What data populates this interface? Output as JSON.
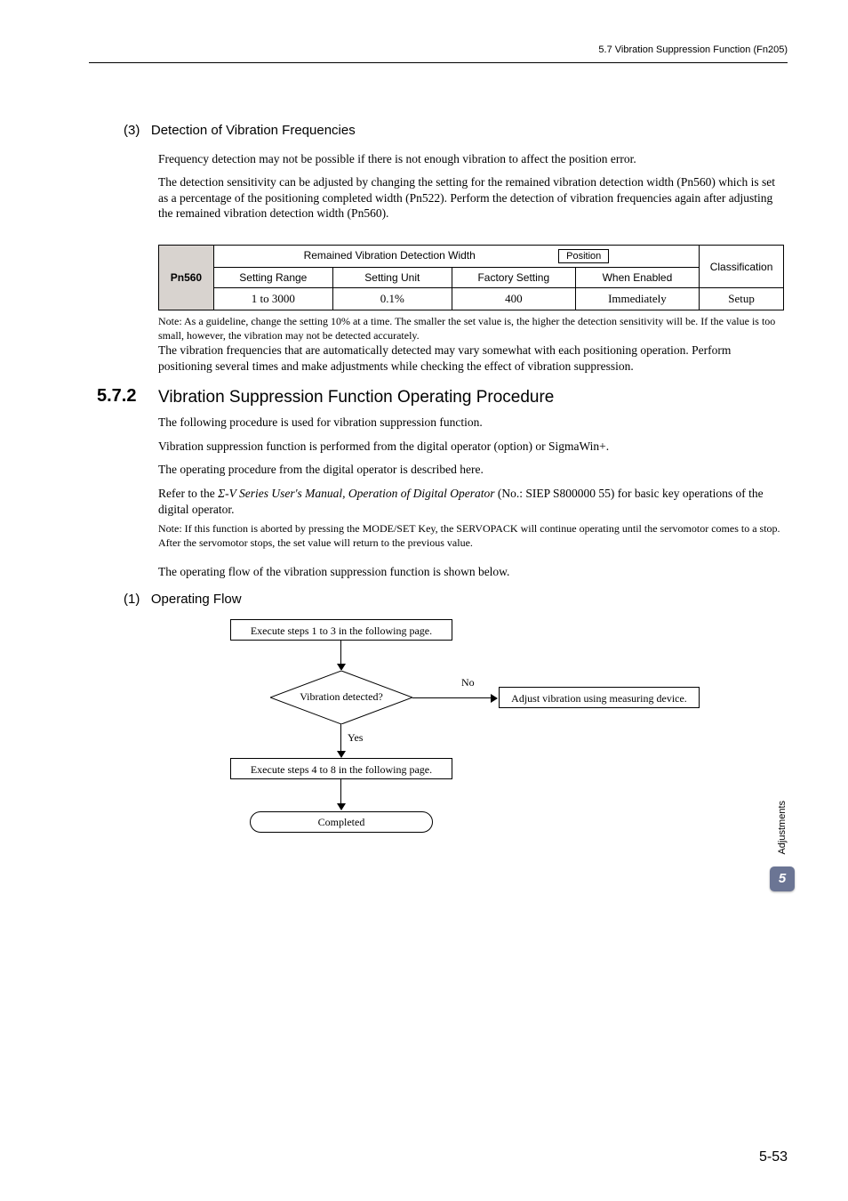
{
  "header": {
    "breadcrumb": "5.7  Vibration Suppression Function (Fn205)"
  },
  "section3": {
    "num": "(3)",
    "title": "Detection of Vibration Frequencies",
    "p1": "Frequency detection may not be possible if there is not enough vibration to affect the position error.",
    "p2": "The detection sensitivity can be adjusted by changing the setting for the remained vibration detection width (Pn560) which is set as a percentage of the positioning completed width (Pn522). Perform the detection of vibration frequencies again after adjusting the remained vibration detection width (Pn560)."
  },
  "param_table": {
    "pn": "Pn560",
    "title": "Remained Vibration Detection Width",
    "position_label": "Position",
    "classification_label": "Classification",
    "headers": {
      "range": "Setting Range",
      "unit": "Setting Unit",
      "factory": "Factory Setting",
      "enabled": "When Enabled"
    },
    "values": {
      "range": "1 to 3000",
      "unit": "0.1%",
      "factory": "400",
      "enabled": "Immediately",
      "classification": "Setup"
    }
  },
  "note1": {
    "prefix": "Note:",
    "body": "As a guideline, change the setting 10% at a time. The smaller the set value is, the higher the detection sensitivity will be. If the value is too small, however, the vibration may not be detected accurately."
  },
  "p3": "The vibration frequencies that are automatically detected may vary somewhat with each positioning operation. Perform positioning several times and make adjustments while checking the effect of vibration suppression.",
  "section572": {
    "num": "5.7.2",
    "title": "Vibration Suppression Function Operating Procedure",
    "p4": "The following procedure is used for vibration suppression function.",
    "p5": "Vibration suppression function is performed from the digital operator (option) or SigmaWin+.",
    "p6": "The operating procedure from the digital operator is described here.",
    "p7_pre": "Refer to the ",
    "p7_sigma": "Σ",
    "p7_italic": "-V Series User's Manual, Operation of Digital Operator",
    "p7_post": " (No.: SIEP S800000 55) for basic key operations of the digital operator.",
    "note2_prefix": "Note:",
    "note2_body": "If this function is aborted by pressing the MODE/SET Key, the SERVOPACK will continue operating until the servomotor comes to a stop. After the servomotor stops, the set value will return to the previous value.",
    "p8": "The operating flow of the vibration suppression function is shown below."
  },
  "section1flow": {
    "num": "(1)",
    "title": "Operating Flow",
    "box1": "Execute steps 1 to 3 in the following page.",
    "decision": "Vibration detected?",
    "no": "No",
    "yes": "Yes",
    "box2": "Adjust vibration using measuring device.",
    "box3": "Execute steps 4 to 8 in the following page.",
    "terminal": "Completed"
  },
  "side": {
    "label": "Adjustments",
    "chapter": "5"
  },
  "page_num": "5-53"
}
